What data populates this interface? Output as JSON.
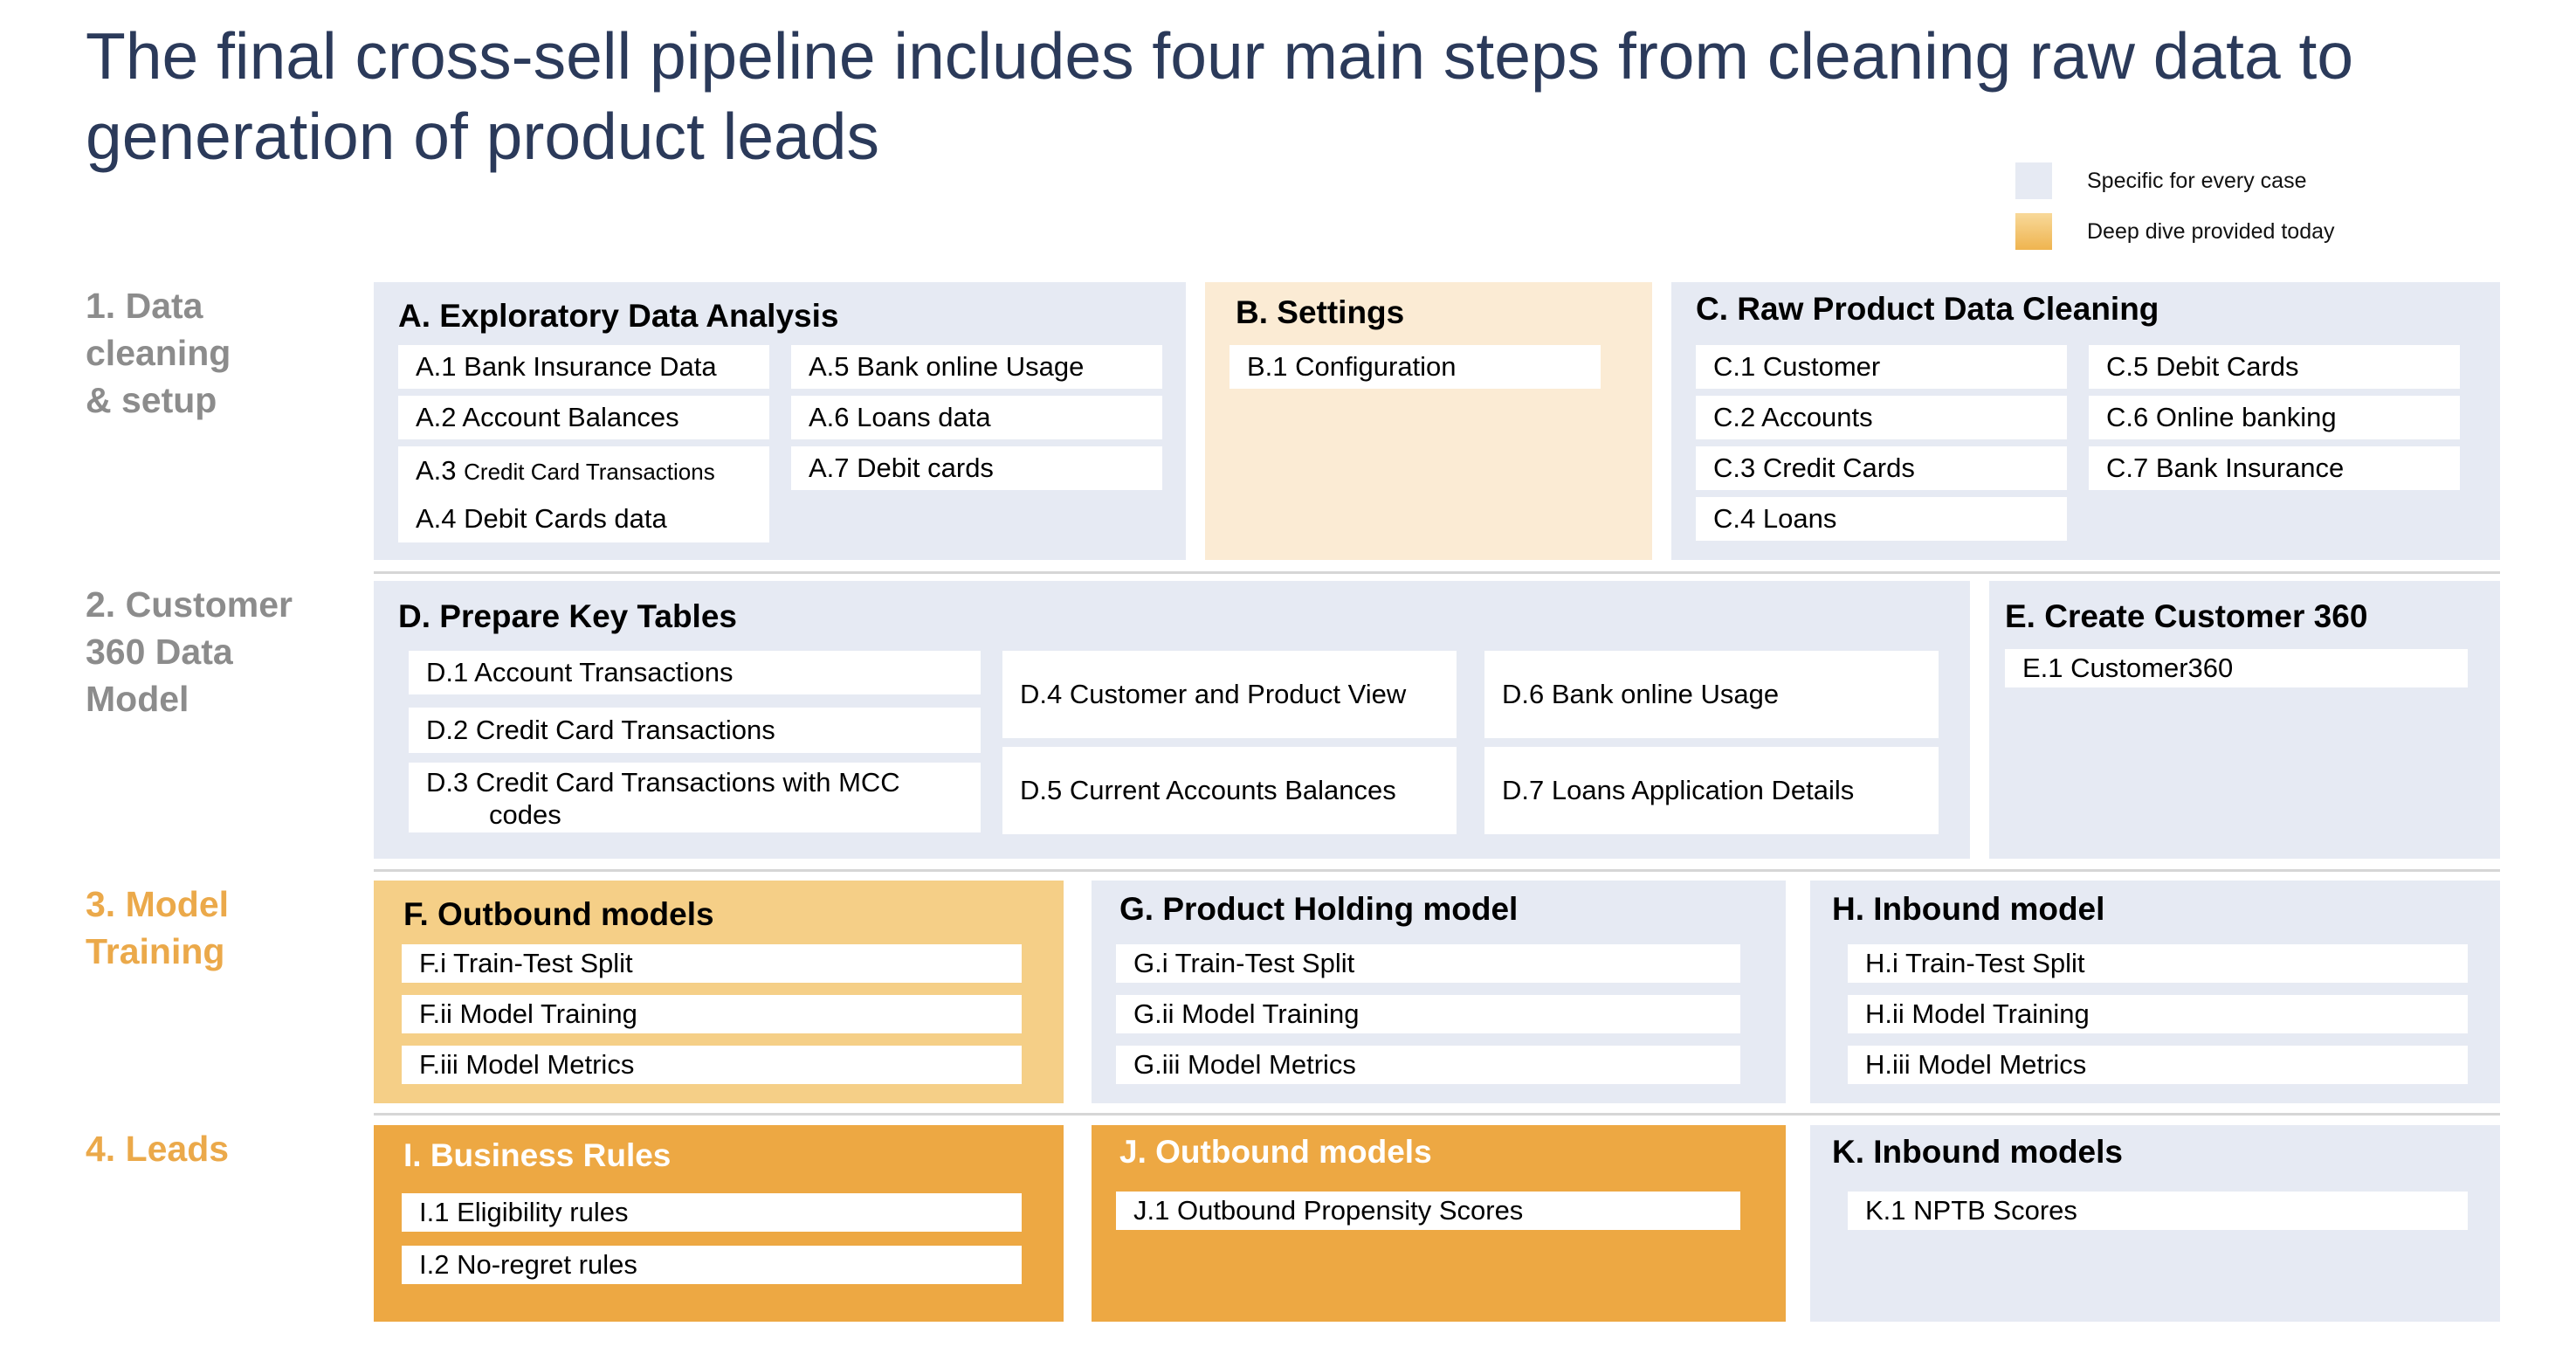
{
  "title": "The final cross-sell pipeline includes four main steps from cleaning raw data to generation of product leads",
  "legend": {
    "specific": {
      "label": "Specific for every case",
      "color": "#e6eaf3"
    },
    "deep_dive": {
      "label": "Deep dive provided today",
      "color": "#f5c874"
    }
  },
  "rows": {
    "r1": "1. Data\ncleaning\n& setup",
    "r2": "2. Customer\n360 Data\nModel",
    "r3": "3. Model\nTraining",
    "r4": "4. Leads"
  },
  "panels": {
    "A": {
      "title": "A. Exploratory Data Analysis",
      "items": [
        "A.1  Bank Insurance Data",
        "A.2  Account Balances",
        "A.3 ",
        "Credit Card Transactions",
        "A.4 Debit Cards data",
        "A.5 Bank online Usage",
        "A.6 Loans data",
        "A.7 Debit cards"
      ]
    },
    "B": {
      "title": "B. Settings",
      "items": [
        "B.1 Configuration"
      ]
    },
    "C": {
      "title": "C. Raw Product Data Cleaning",
      "items": [
        "C.1  Customer",
        "C.2  Accounts",
        "C.3 Credit Cards",
        "C.4 Loans",
        "C.5 Debit Cards",
        "C.6 Online banking",
        "C.7 Bank Insurance"
      ]
    },
    "D": {
      "title": "D. Prepare Key Tables",
      "items": [
        "D.1  Account Transactions",
        "D.2 Credit Card Transactions",
        "D.3 Credit Card Transactions with MCC",
        "codes",
        "D.4 Customer and Product View",
        "D.5 Current Accounts Balances",
        "D.6 Bank online Usage",
        "D.7 Loans Application Details"
      ]
    },
    "E": {
      "title": "E. Create Customer 360",
      "items": [
        "E.1 Customer360"
      ]
    },
    "F": {
      "title": "F. Outbound models",
      "items": [
        "F.i  Train-Test Split",
        "F.ii Model Training",
        "F.iii Model Metrics"
      ]
    },
    "G": {
      "title": "G. Product Holding model",
      "items": [
        "G.i  Train-Test Split",
        "G.ii Model Training",
        "G.iii Model Metrics"
      ]
    },
    "H": {
      "title": "H. Inbound model",
      "items": [
        "H.i  Train-Test Split",
        "H.ii Model Training",
        "H.iii Model Metrics"
      ]
    },
    "I": {
      "title": "I. Business Rules",
      "items": [
        "I.1 Eligibility rules",
        "I.2 No-regret rules"
      ]
    },
    "J": {
      "title": "J. Outbound models",
      "items": [
        "J.1  Outbound Propensity Scores"
      ]
    },
    "K": {
      "title": "K. Inbound models",
      "items": [
        "K.1  NPTB Scores"
      ]
    }
  }
}
